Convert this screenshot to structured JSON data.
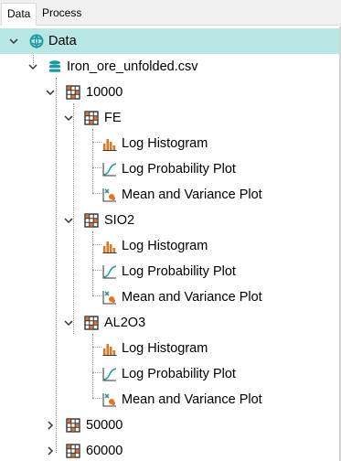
{
  "tabs": [
    {
      "label": "Data",
      "active": true
    },
    {
      "label": "Process",
      "active": false
    }
  ],
  "tree": {
    "root": {
      "label": "Data"
    },
    "file": {
      "label": "Iron_ore_unfolded.csv"
    },
    "group_10000": {
      "label": "10000"
    },
    "group_50000": {
      "label": "50000"
    },
    "group_60000": {
      "label": "60000"
    },
    "variables": [
      {
        "label": "FE"
      },
      {
        "label": "SIO2"
      },
      {
        "label": "AL2O3"
      }
    ],
    "plots": {
      "histogram": "Log Histogram",
      "probability": "Log Probability Plot",
      "mean_variance": "Mean and Variance Plot"
    }
  },
  "colors": {
    "selection": "#b8e8e6",
    "accent": "#1a9aa0",
    "histogram": "#e8731a",
    "grid_orange": "#e8731a"
  }
}
